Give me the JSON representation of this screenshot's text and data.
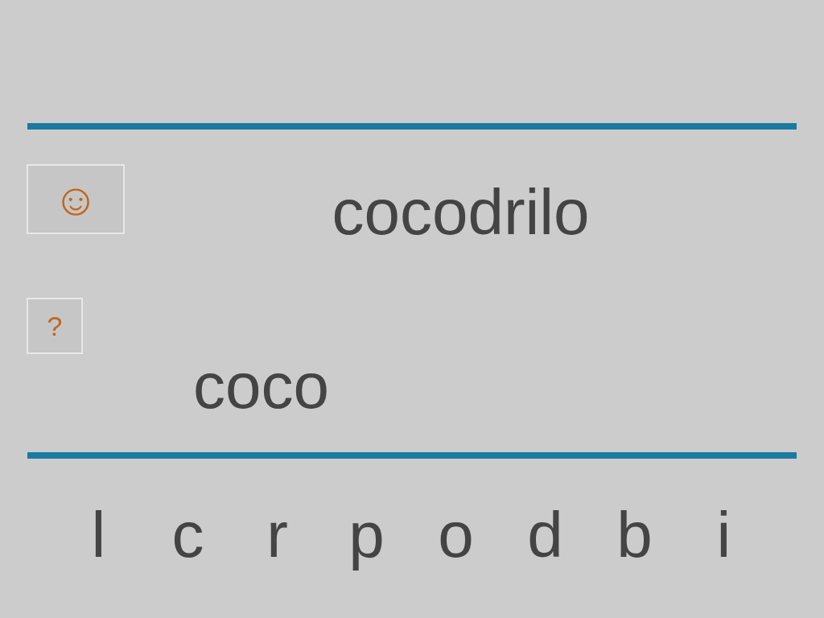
{
  "check_button": {
    "label": "☺"
  },
  "word": "cocodrilo",
  "hint_button": {
    "label": "?"
  },
  "answer": "coco",
  "letters": [
    "l",
    "c",
    "r",
    "p",
    "o",
    "d",
    "b",
    "i"
  ]
}
